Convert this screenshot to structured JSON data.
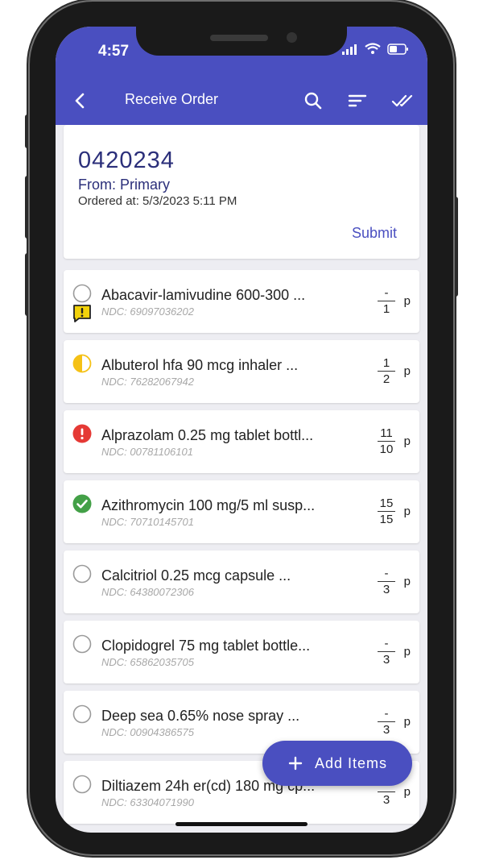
{
  "status_bar": {
    "time": "4:57"
  },
  "app_bar": {
    "title": "Receive Order"
  },
  "order": {
    "number": "0420234",
    "from": "From: Primary",
    "ordered_at": "Ordered at: 5/3/2023 5:11 PM",
    "submit_label": "Submit"
  },
  "items": [
    {
      "name": "Abacavir-lamivudine 600-300 ...",
      "ndc": "NDC: 69097036202",
      "received": "-",
      "ordered": "1",
      "unit": "p",
      "status": "not-started",
      "warning": true
    },
    {
      "name": "Albuterol hfa 90 mcg inhaler ...",
      "ndc": "NDC: 76282067942",
      "received": "1",
      "ordered": "2",
      "unit": "p",
      "status": "partial",
      "warning": false
    },
    {
      "name": "Alprazolam 0.25 mg tablet bottl...",
      "ndc": "NDC: 00781106101",
      "received": "11",
      "ordered": "10",
      "unit": "p",
      "status": "error",
      "warning": false
    },
    {
      "name": "Azithromycin 100 mg/5 ml susp...",
      "ndc": "NDC: 70710145701",
      "received": "15",
      "ordered": "15",
      "unit": "p",
      "status": "complete",
      "warning": false
    },
    {
      "name": "Calcitriol 0.25 mcg capsule ...",
      "ndc": "NDC: 64380072306",
      "received": "-",
      "ordered": "3",
      "unit": "p",
      "status": "not-started",
      "warning": false
    },
    {
      "name": "Clopidogrel 75 mg tablet bottle...",
      "ndc": "NDC: 65862035705",
      "received": "-",
      "ordered": "3",
      "unit": "p",
      "status": "not-started",
      "warning": false
    },
    {
      "name": "Deep sea 0.65% nose spray ...",
      "ndc": "NDC: 00904386575",
      "received": "-",
      "ordered": "3",
      "unit": "p",
      "status": "not-started",
      "warning": false
    },
    {
      "name": "Diltiazem 24h er(cd) 180 mg cp...",
      "ndc": "NDC: 63304071990",
      "received": "-",
      "ordered": "3",
      "unit": "p",
      "status": "not-started",
      "warning": false
    }
  ],
  "fab": {
    "label": "Add Items"
  },
  "colors": {
    "primary": "#4a4fc0",
    "order_text": "#2b2f7a",
    "warning": "#f2d20b",
    "partial": "#f5c116",
    "error": "#e53935",
    "complete": "#43a047"
  },
  "icons": {
    "back": "chevron-left-icon",
    "search": "search-icon",
    "sort": "sort-icon",
    "select_all": "double-check-icon",
    "add": "plus-icon"
  }
}
